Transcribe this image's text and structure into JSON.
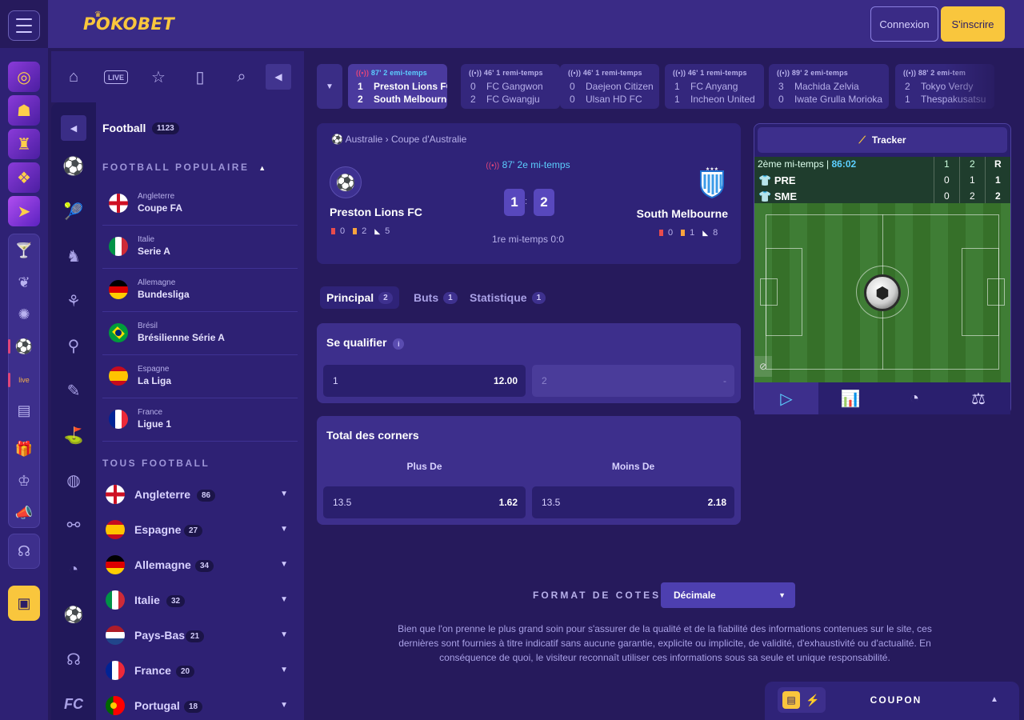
{
  "header": {
    "logo": "POKOBET",
    "login": "Connexion",
    "signup": "S'inscrire"
  },
  "rail": {
    "live_badge": "live"
  },
  "sport_bar": {
    "live_label": "LIVE"
  },
  "sidebar": {
    "title": "Football",
    "count": "1123",
    "popular_heading": "FOOTBALL POPULAIRE",
    "popular": [
      {
        "country": "Angleterre",
        "league": "Coupe FA"
      },
      {
        "country": "Italie",
        "league": "Serie A"
      },
      {
        "country": "Allemagne",
        "league": "Bundesliga"
      },
      {
        "country": "Brésil",
        "league": "Brésilienne Série A"
      },
      {
        "country": "Espagne",
        "league": "La Liga"
      },
      {
        "country": "France",
        "league": "Ligue 1"
      }
    ],
    "all_heading": "TOUS FOOTBALL",
    "all": [
      {
        "name": "Angleterre",
        "count": "86"
      },
      {
        "name": "Espagne",
        "count": "27"
      },
      {
        "name": "Allemagne",
        "count": "34"
      },
      {
        "name": "Italie",
        "count": "32"
      },
      {
        "name": "Pays-Bas",
        "count": "21"
      },
      {
        "name": "France",
        "count": "20"
      },
      {
        "name": "Portugal",
        "count": "18"
      }
    ]
  },
  "live_strip": [
    {
      "time": "87' 2 emi-temps",
      "home_score": "1",
      "home": "Preston Lions FC",
      "away_score": "2",
      "away": "South Melbourne"
    },
    {
      "time": "46' 1 remi-temps",
      "home_score": "0",
      "home": "FC Gangwon",
      "away_score": "2",
      "away": "FC Gwangju"
    },
    {
      "time": "46' 1 remi-temps",
      "home_score": "0",
      "home": "Daejeon Citizen",
      "away_score": "0",
      "away": "Ulsan HD FC"
    },
    {
      "time": "46' 1 remi-temps",
      "home_score": "1",
      "home": "FC Anyang",
      "away_score": "1",
      "away": "Incheon United"
    },
    {
      "time": "89' 2 emi-temps",
      "home_score": "3",
      "home": "Machida Zelvia",
      "away_score": "0",
      "away": "Iwate Grulla Morioka"
    },
    {
      "time": "88' 2 emi-tem",
      "home_score": "2",
      "home": "Tokyo Verdy",
      "away_score": "1",
      "away": "Thespakusatsu"
    }
  ],
  "match": {
    "country": "Australie",
    "competition": "Coupe d'Australie",
    "home": "Preston Lions FC",
    "away": "South Melbourne",
    "time": "87' 2e mi-temps",
    "home_score": "1",
    "away_score": "2",
    "separator": ":",
    "half_time": "1re mi-temps 0:0",
    "home_cards": {
      "red": "0",
      "yellow": "2",
      "corners": "5"
    },
    "away_cards": {
      "red": "0",
      "yellow": "1",
      "corners": "8"
    }
  },
  "tabs": [
    {
      "label": "Principal",
      "count": "2"
    },
    {
      "label": "Buts",
      "count": "1"
    },
    {
      "label": "Statistique",
      "count": "1"
    }
  ],
  "markets": {
    "qualify": {
      "title": "Se qualifier",
      "opt1_label": "1",
      "opt1_value": "12.00",
      "opt2_label": "2",
      "opt2_value": "-"
    },
    "corners": {
      "title": "Total des corners",
      "col1": "Plus De",
      "col2": "Moins De",
      "opt1_label": "13.5",
      "opt1_value": "1.62",
      "opt2_label": "13.5",
      "opt2_value": "2.18"
    }
  },
  "tracker": {
    "button": "Tracker",
    "period": "2ème mi-temps",
    "clock": "86:02",
    "col1": "1",
    "col2": "2",
    "colR": "R",
    "home_abbr": "PRE",
    "home_h1": "0",
    "home_h2": "1",
    "home_r": "1",
    "away_abbr": "SME",
    "away_h1": "0",
    "away_h2": "2",
    "away_r": "2"
  },
  "footer": {
    "odds_format_label": "FORMAT DE COTES",
    "odds_format_value": "Décimale",
    "disclaimer": "Bien que l'on prenne le plus grand soin pour s'assurer de la qualité et de la fiabilité des informations contenues sur le site, ces dernières sont fournies à titre indicatif sans aucune garantie, explicite ou implicite, de validité, d'exhaustivité ou d'actualité. En conséquence de quoi, le visiteur reconnaît utiliser ces informations sous sa seule et unique responsabilité."
  },
  "coupon": {
    "label": "COUPON"
  },
  "colors": {
    "accent": "#f9c63d",
    "live": "#5ccfff",
    "bg": "#261a5c"
  }
}
